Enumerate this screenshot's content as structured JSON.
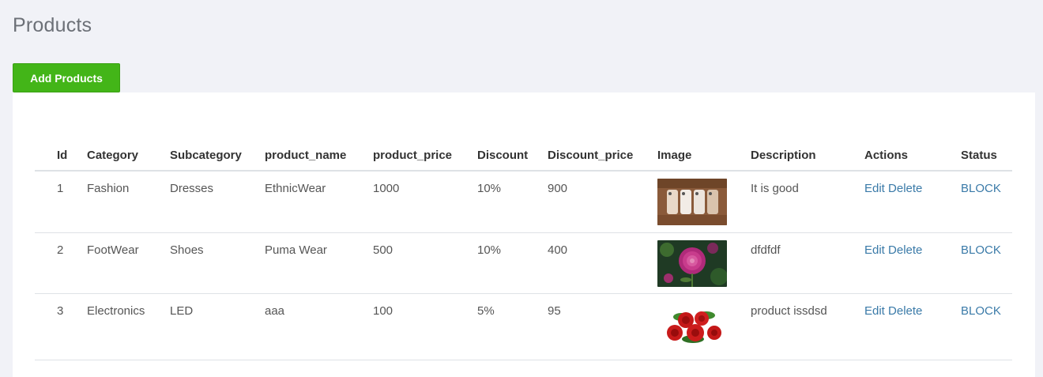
{
  "page": {
    "title": "Products"
  },
  "toolbar": {
    "add_label": "Add Products",
    "accent": "#43b518"
  },
  "table": {
    "headers": [
      "Id",
      "Category",
      "Subcategory",
      "product_name",
      "product_price",
      "Discount",
      "Discount_price",
      "Image",
      "Description",
      "Actions",
      "Status"
    ],
    "rows": [
      {
        "id": "1",
        "category": "Fashion",
        "subcategory": "Dresses",
        "product_name": "EthnicWear",
        "product_price": "1000",
        "discount": "10%",
        "discount_price": "900",
        "image": "phones-photo",
        "description": "It is good",
        "edit": "Edit",
        "delete": "Delete",
        "status": "BLOCK"
      },
      {
        "id": "2",
        "category": "FootWear",
        "subcategory": "Shoes",
        "product_name": "Puma Wear",
        "product_price": "500",
        "discount": "10%",
        "discount_price": "400",
        "image": "flower-photo",
        "description": "dfdfdf",
        "edit": "Edit",
        "delete": "Delete",
        "status": "BLOCK"
      },
      {
        "id": "3",
        "category": "Electronics",
        "subcategory": "LED",
        "product_name": "aaa",
        "product_price": "100",
        "discount": "5%",
        "discount_price": "95",
        "image": "roses-photo",
        "description": "product issdsd",
        "edit": "Edit",
        "delete": "Delete",
        "status": "BLOCK"
      }
    ]
  },
  "colors": {
    "link": "#3a7aa8",
    "header_text": "#333333",
    "body_text": "#555555",
    "background": "#f1f2f7"
  }
}
